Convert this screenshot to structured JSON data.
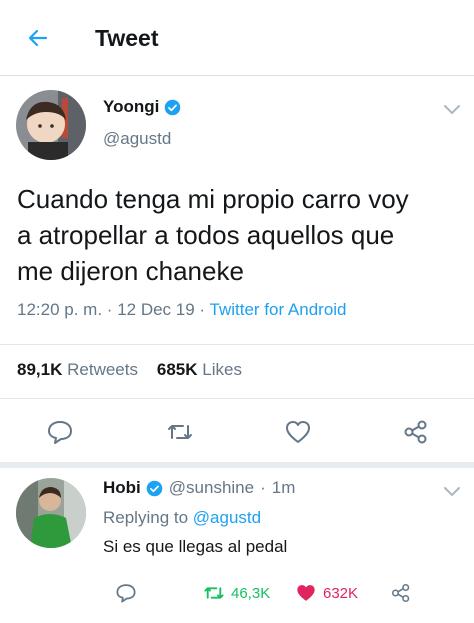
{
  "header": {
    "title": "Tweet",
    "back_icon": "arrow-left-icon"
  },
  "tweet": {
    "author_name": "Yoongi",
    "author_handle": "@agustd",
    "text_lines": [
      "Cuando tenga mi propio carro voy",
      "a atropellar a todos aquellos que",
      "me dijeron chaneke"
    ],
    "time": "12:20 p. m.",
    "date": "12 Dec 19",
    "source": "Twitter for Android",
    "retweets_count": "89,1K",
    "retweets_label": "Retweets",
    "likes_count": "685K",
    "likes_label": "Likes"
  },
  "reply": {
    "author_name": "Hobi",
    "author_handle": "@sunshine",
    "age": "1m",
    "replying_prefix": "Replying to",
    "replying_to": "@agustd",
    "text": "Si es que llegas al pedal",
    "retweets_count": "46,3K",
    "likes_count": "632K"
  },
  "colors": {
    "accent": "#1da1f2",
    "like_active": "#e0245e",
    "retweet_active": "#17bf63",
    "secondary_text": "#657786"
  }
}
